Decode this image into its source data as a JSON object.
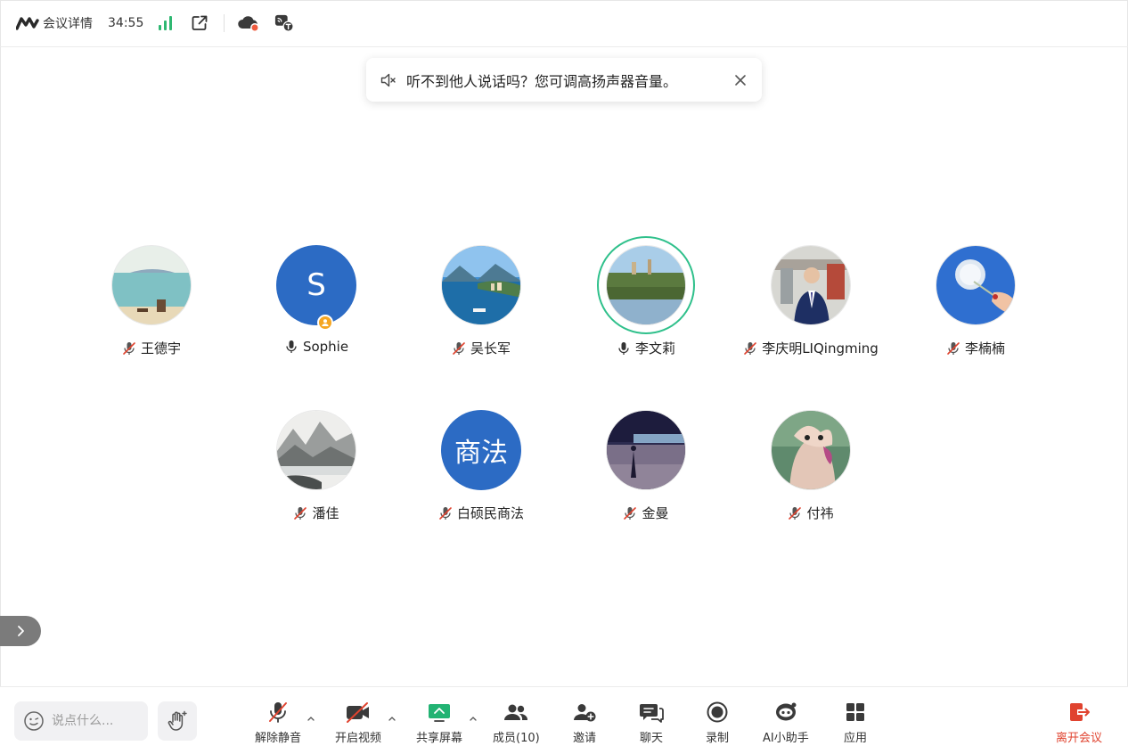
{
  "topbar": {
    "meeting_info_label": "会议详情",
    "elapsed_time": "34:55"
  },
  "toast": {
    "message": "听不到他人说话吗？您可调高扬声器音量。"
  },
  "participants": [
    {
      "name": "王德宇",
      "mic": "muted"
    },
    {
      "name": "Sophie",
      "mic": "on",
      "avatar_text": "S",
      "host": true
    },
    {
      "name": "吴长军",
      "mic": "muted"
    },
    {
      "name": "李文莉",
      "mic": "on",
      "speaking": true
    },
    {
      "name": "李庆明LIQingming",
      "mic": "muted"
    },
    {
      "name": "李楠楠",
      "mic": "muted"
    },
    {
      "name": "潘佳",
      "mic": "muted"
    },
    {
      "name": "白硕民商法",
      "mic": "muted",
      "avatar_text": "商法"
    },
    {
      "name": "金曼",
      "mic": "muted"
    },
    {
      "name": "付祎",
      "mic": "muted"
    }
  ],
  "bottombar": {
    "chat_placeholder": "说点什么...",
    "unmute_label": "解除静音",
    "video_label": "开启视频",
    "share_label": "共享屏幕",
    "members_label": "成员(10)",
    "invite_label": "邀请",
    "chat_label": "聊天",
    "record_label": "录制",
    "ai_label": "AI小助手",
    "apps_label": "应用",
    "leave_label": "离开会议"
  },
  "colors": {
    "accent_green": "#2fb872",
    "speaking_ring": "#2fc08b",
    "avatar_blue": "#2c6bc4",
    "muted_red": "#e0432f",
    "leave_red": "#e0432f",
    "host_badge": "#f5a623"
  }
}
